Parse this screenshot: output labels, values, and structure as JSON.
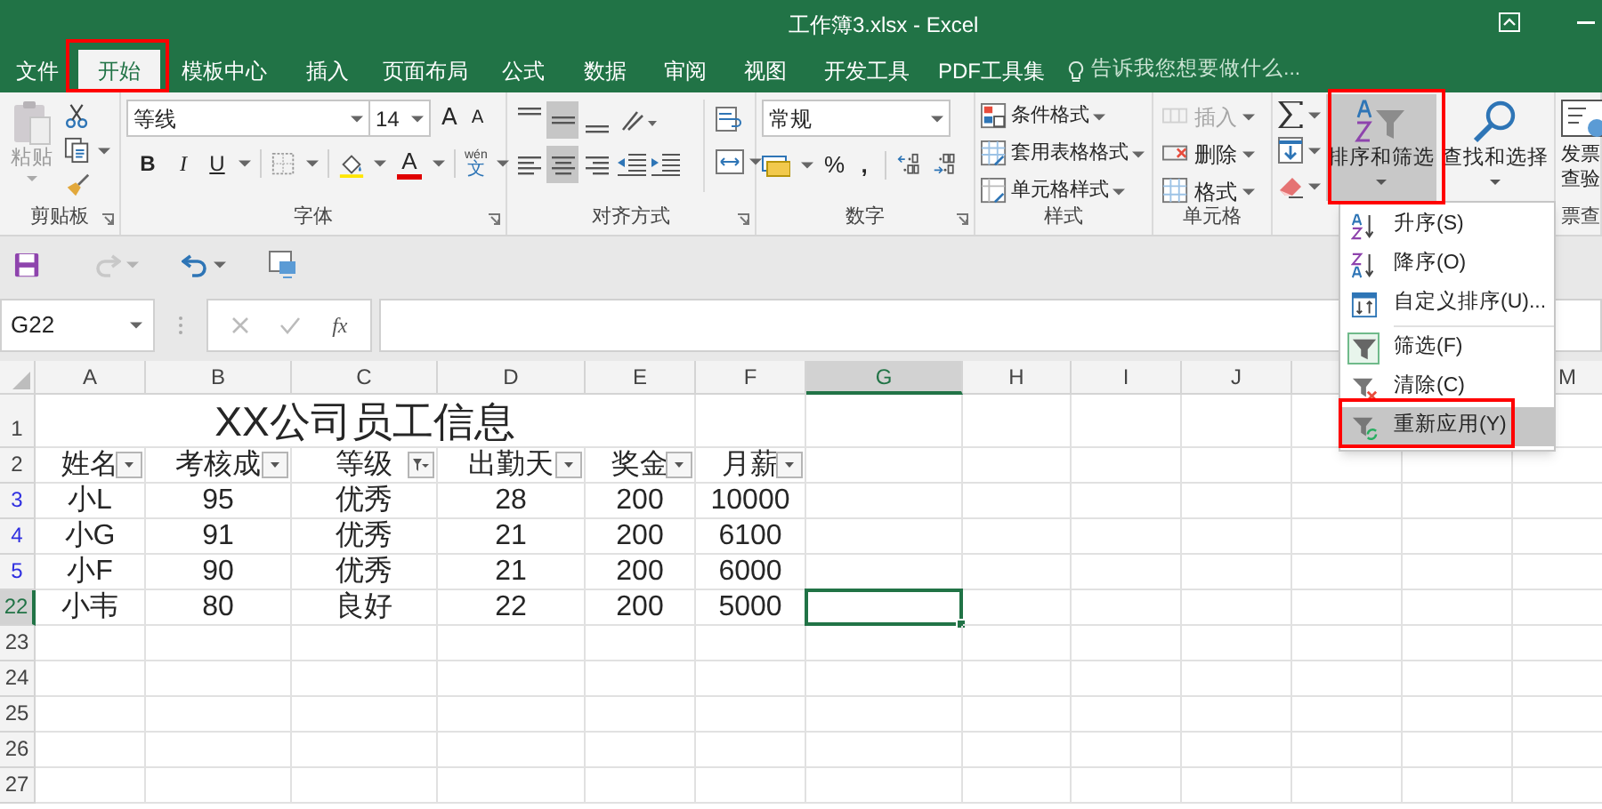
{
  "title_bar": {
    "title": "工作簿3.xlsx - Excel"
  },
  "tabs": [
    {
      "label": "文件",
      "selected": false
    },
    {
      "label": "开始",
      "selected": true
    },
    {
      "label": "模板中心",
      "selected": false
    },
    {
      "label": "插入",
      "selected": false
    },
    {
      "label": "页面布局",
      "selected": false
    },
    {
      "label": "公式",
      "selected": false
    },
    {
      "label": "数据",
      "selected": false
    },
    {
      "label": "审阅",
      "selected": false
    },
    {
      "label": "视图",
      "selected": false
    },
    {
      "label": "开发工具",
      "selected": false
    },
    {
      "label": "PDF工具集",
      "selected": false
    }
  ],
  "tell_me": {
    "placeholder": "告诉我您想要做什么..."
  },
  "ribbon": {
    "clipboard": {
      "paste": "粘贴",
      "label": "剪贴板"
    },
    "font": {
      "font_name": "等线",
      "font_size": "14",
      "grow": "A",
      "shrink": "A",
      "bold": "B",
      "italic": "I",
      "underline": "U",
      "color_letter": "A",
      "phonetic": {
        "pinyin": "wén",
        "char": "文"
      },
      "label": "字体"
    },
    "alignment": {
      "vertical": [
        {
          "selected": false
        },
        {
          "selected": true
        },
        {
          "selected": false
        }
      ],
      "horizontal": [
        {
          "selected": false
        },
        {
          "selected": true
        },
        {
          "selected": false
        }
      ],
      "label": "对齐方式"
    },
    "number": {
      "format": "常规",
      "percent": "%",
      "comma": ",",
      "label": "数字"
    },
    "styles": {
      "items": [
        "条件格式",
        "套用表格格式",
        "单元格样式"
      ],
      "label": "样式"
    },
    "cells": {
      "items": [
        {
          "label": "插入",
          "disabled": true
        },
        {
          "label": "删除",
          "disabled": false
        },
        {
          "label": "格式",
          "disabled": false
        }
      ],
      "label": "单元格"
    },
    "editing": {
      "sort_filter": {
        "label": "排序和筛选",
        "pressed": true
      },
      "find_select": "查找和选择"
    },
    "invoice": {
      "lines": [
        "发票",
        "查验"
      ],
      "group_label": "票查"
    }
  },
  "formula_bar": {
    "name_box": "G22",
    "function_label": "fx"
  },
  "sheet": {
    "columns": [
      {
        "letter": "A",
        "selected": false
      },
      {
        "letter": "B",
        "selected": false
      },
      {
        "letter": "C",
        "selected": false
      },
      {
        "letter": "D",
        "selected": false
      },
      {
        "letter": "E",
        "selected": false
      },
      {
        "letter": "F",
        "selected": false
      },
      {
        "letter": "G",
        "selected": true
      },
      {
        "letter": "H",
        "selected": false
      },
      {
        "letter": "I",
        "selected": false
      },
      {
        "letter": "J",
        "selected": false
      },
      {
        "letter": "M",
        "selected": false
      }
    ],
    "title": "XX公司员工信息",
    "headers": [
      {
        "text": "姓名",
        "filtered": false
      },
      {
        "text": "考核成",
        "filtered": false
      },
      {
        "text": "等级",
        "filtered": true
      },
      {
        "text": "出勤天",
        "filtered": false
      },
      {
        "text": "奖金",
        "filtered": false
      },
      {
        "text": "月薪",
        "filtered": false
      }
    ],
    "rows": [
      {
        "number": "1",
        "kind": "title",
        "filtered": false,
        "selected": false
      },
      {
        "number": "2",
        "kind": "header",
        "filtered": false,
        "selected": false
      },
      {
        "number": "3",
        "kind": "data",
        "filtered": true,
        "selected": false,
        "cells": [
          "小L",
          "95",
          "优秀",
          "28",
          "200",
          "10000"
        ]
      },
      {
        "number": "4",
        "kind": "data",
        "filtered": true,
        "selected": false,
        "cells": [
          "小G",
          "91",
          "优秀",
          "21",
          "200",
          "6100"
        ]
      },
      {
        "number": "5",
        "kind": "data",
        "filtered": true,
        "selected": false,
        "cells": [
          "小F",
          "90",
          "优秀",
          "21",
          "200",
          "6000"
        ]
      },
      {
        "number": "22",
        "kind": "data",
        "filtered": false,
        "selected": true,
        "cells": [
          "小韦",
          "80",
          "良好",
          "22",
          "200",
          "5000"
        ]
      },
      {
        "number": "23",
        "kind": "empty",
        "filtered": false,
        "selected": false
      },
      {
        "number": "24",
        "kind": "empty",
        "filtered": false,
        "selected": false
      },
      {
        "number": "25",
        "kind": "empty",
        "filtered": false,
        "selected": false
      },
      {
        "number": "26",
        "kind": "empty",
        "filtered": false,
        "selected": false
      },
      {
        "number": "27",
        "kind": "empty",
        "filtered": false,
        "selected": false
      }
    ]
  },
  "sort_menu": {
    "items": [
      {
        "kind": "ascending",
        "label": "升序(S)",
        "checked": false,
        "highlighted": false
      },
      {
        "kind": "descending",
        "label": "降序(O)",
        "checked": false,
        "highlighted": false
      },
      {
        "kind": "custom",
        "label": "自定义排序(U)...",
        "checked": false,
        "highlighted": false
      },
      {
        "kind": "filter",
        "label": "筛选(F)",
        "checked": true,
        "highlighted": false
      },
      {
        "kind": "clear",
        "label": "清除(C)",
        "checked": false,
        "highlighted": false
      },
      {
        "kind": "reapply",
        "label": "重新应用(Y)",
        "checked": false,
        "highlighted": true
      }
    ]
  }
}
